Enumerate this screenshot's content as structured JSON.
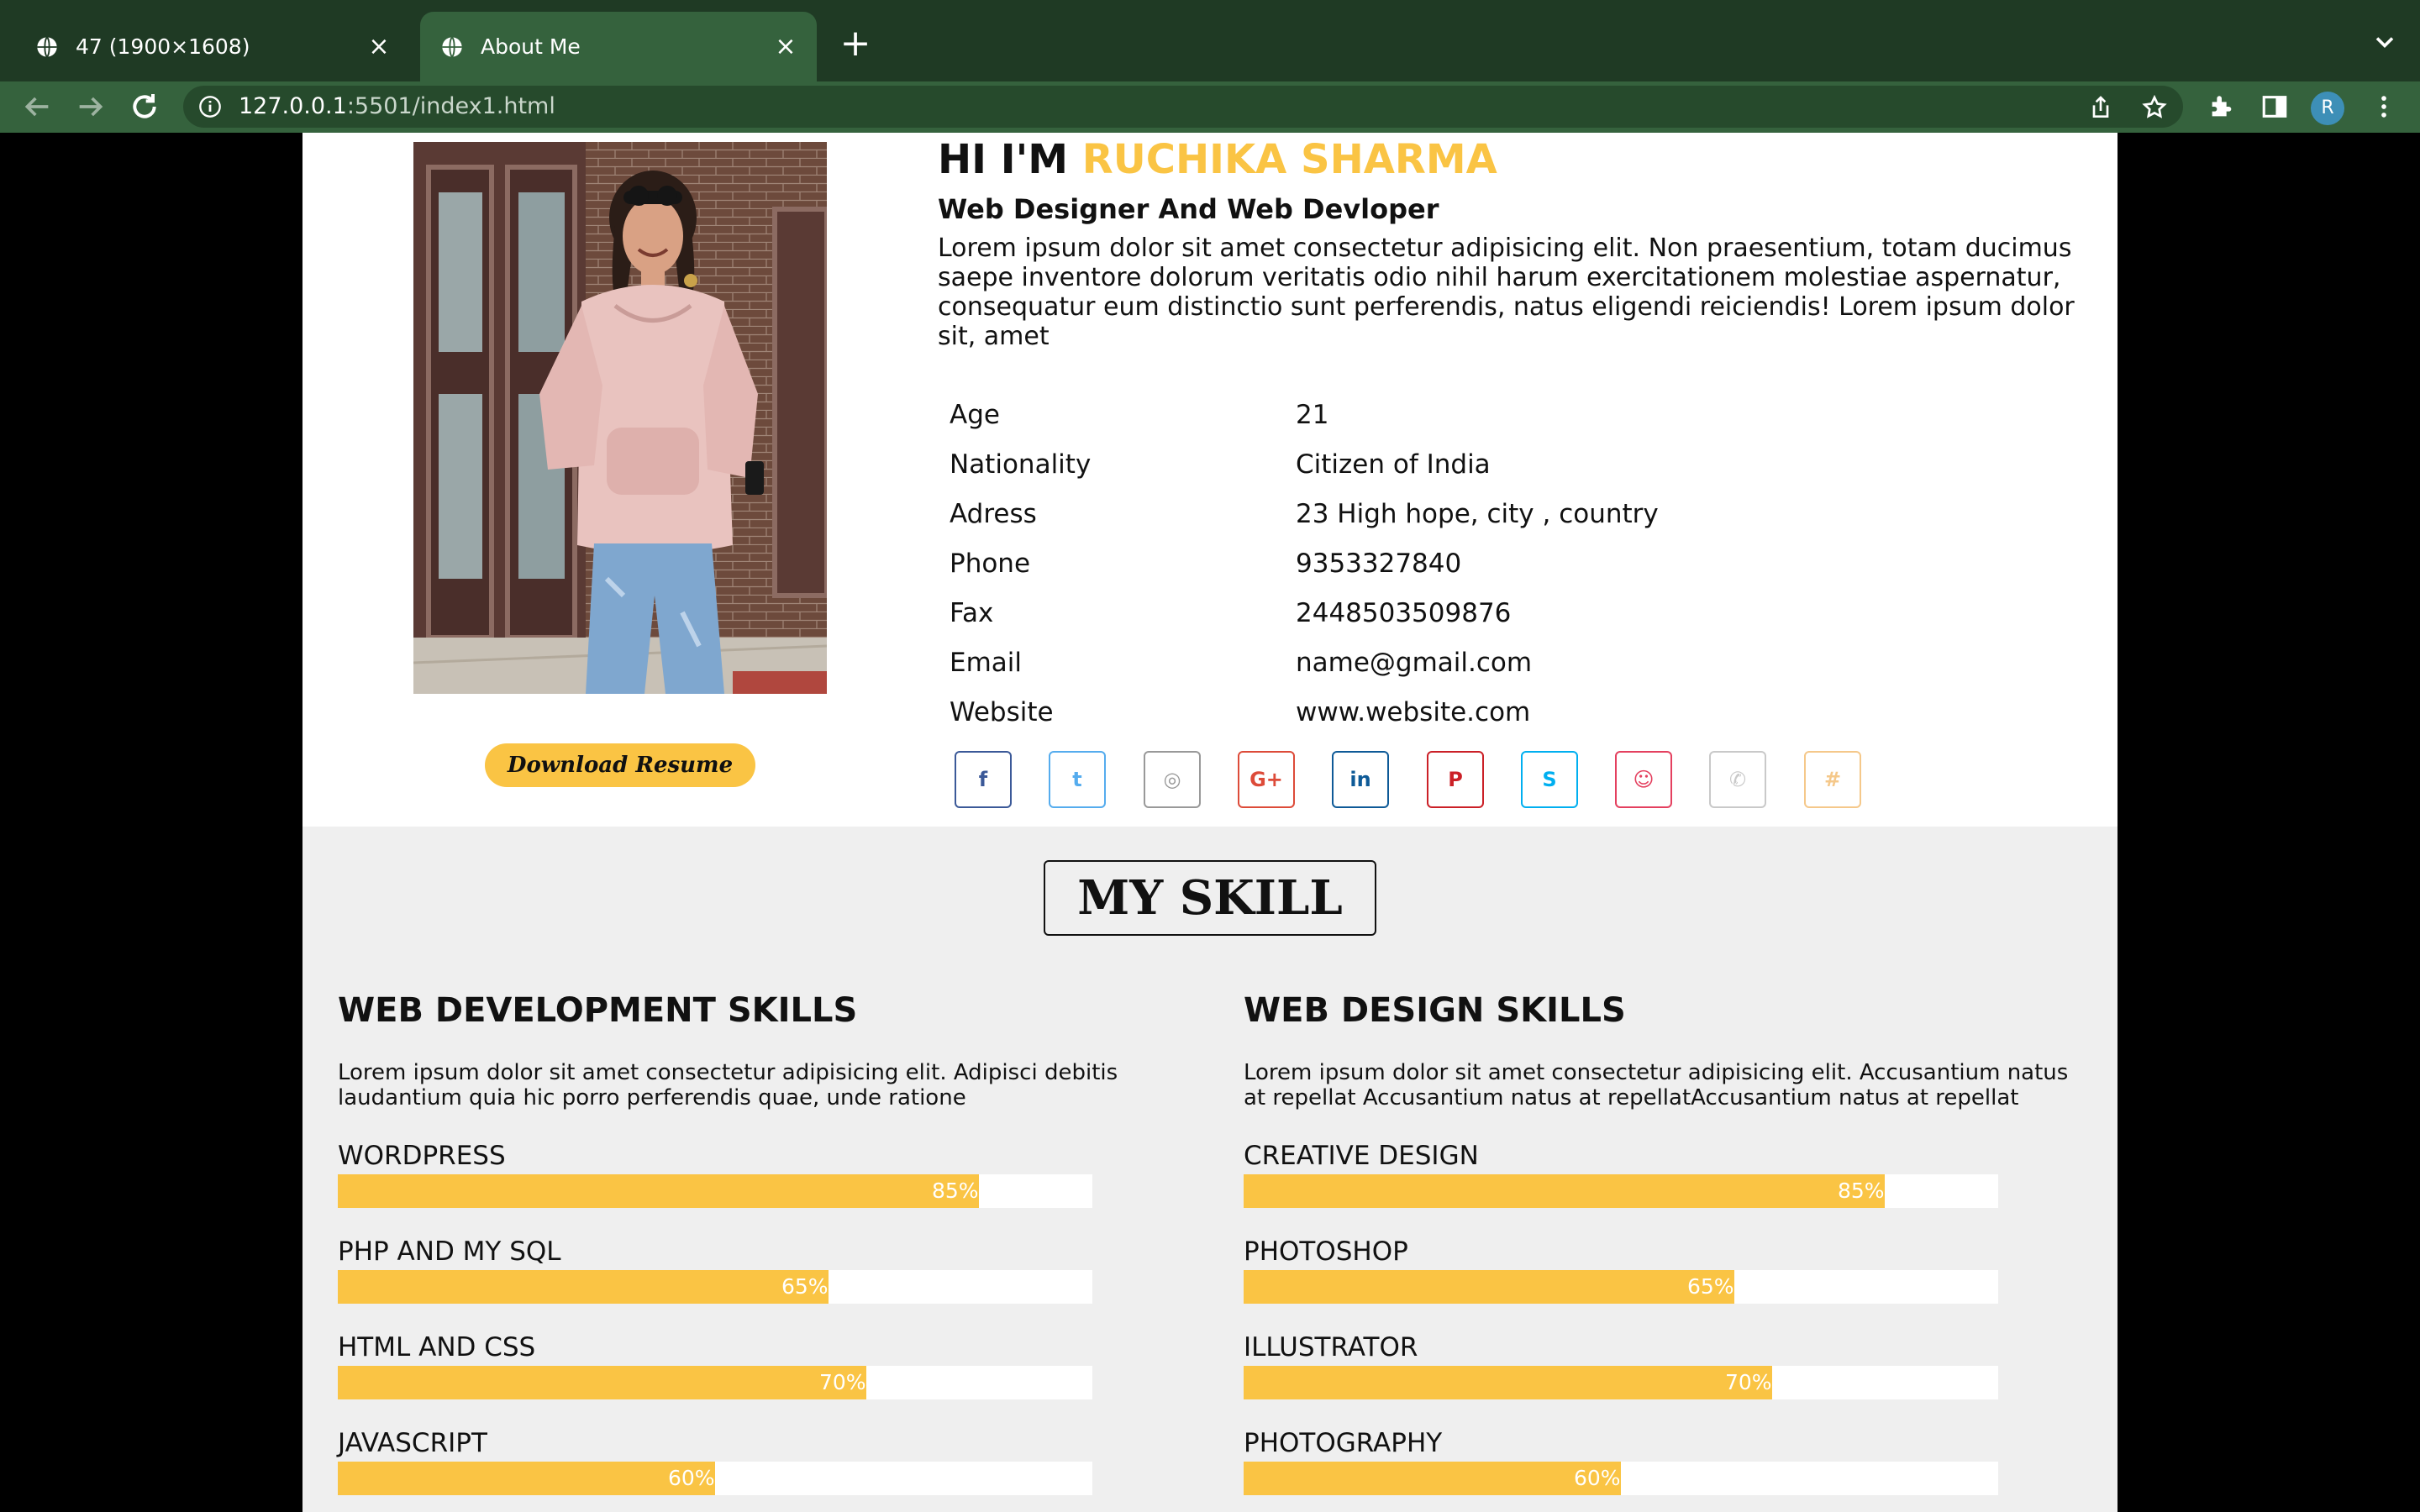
{
  "browser": {
    "tabs": [
      {
        "title": "47 (1900×1608)",
        "active": false
      },
      {
        "title": "About Me",
        "active": true
      }
    ],
    "url_host": "127.0.0.1",
    "url_path": ":5501/index1.html",
    "profile_initial": "R"
  },
  "hero": {
    "greeting": "HI I'M",
    "name": "RUCHIKA SHARMA",
    "role": "Web Designer And Web Devloper",
    "intro": "Lorem ipsum dolor sit amet consectetur adipisicing elit. Non praesentium, totam ducimus saepe inventore dolorum veritatis odio nihil harum exercitationem molestiae aspernatur, consequatur eum distinctio sunt perferendis, natus eligendi reiciendis! Lorem ipsum dolor sit, amet",
    "download_label": "Download Resume"
  },
  "details": [
    {
      "key": "Age",
      "value": "21"
    },
    {
      "key": "Nationality",
      "value": "Citizen of India"
    },
    {
      "key": "Adress",
      "value": "23 High hope, city , country"
    },
    {
      "key": "Phone",
      "value": "9353327840"
    },
    {
      "key": "Fax",
      "value": "2448503509876"
    },
    {
      "key": "Email",
      "value": "name@gmail.com"
    },
    {
      "key": "Website",
      "value": "www.website.com"
    }
  ],
  "social": [
    {
      "name": "facebook",
      "glyph": "f",
      "color": "#3b5998"
    },
    {
      "name": "twitter",
      "glyph": "t",
      "color": "#55acee"
    },
    {
      "name": "instagram",
      "glyph": "◎",
      "color": "#999999"
    },
    {
      "name": "google-plus",
      "glyph": "G+",
      "color": "#dd4b39"
    },
    {
      "name": "linkedin",
      "glyph": "in",
      "color": "#0e5a97"
    },
    {
      "name": "pinterest",
      "glyph": "P",
      "color": "#cb2027"
    },
    {
      "name": "skype",
      "glyph": "S",
      "color": "#00aff0"
    },
    {
      "name": "snapchat",
      "glyph": "☺",
      "color": "#e4405f"
    },
    {
      "name": "whatsapp",
      "glyph": "✆",
      "color": "#c9c9c9"
    },
    {
      "name": "slack",
      "glyph": "#",
      "color": "#f5c88a"
    }
  ],
  "skills": {
    "title": "MY SKILL",
    "columns": [
      {
        "title": "WEB DEVELOPMENT SKILLS",
        "desc": "Lorem ipsum dolor sit amet consectetur adipisicing elit. Adipisci debitis laudantium quia hic porro perferendis quae, unde ratione",
        "items": [
          {
            "label": "WORDPRESS",
            "percent": 85,
            "text": "85%"
          },
          {
            "label": "PHP AND MY SQL",
            "percent": 65,
            "text": "65%"
          },
          {
            "label": "HTML AND CSS",
            "percent": 70,
            "text": "70%"
          },
          {
            "label": "JAVASCRIPT",
            "percent": 50,
            "text": "60%"
          }
        ]
      },
      {
        "title": "WEB DESIGN SKILLS",
        "desc": "Lorem ipsum dolor sit amet consectetur adipisicing elit. Accusantium natus at repellat Accusantium natus at repellatAccusantium natus at repellat",
        "items": [
          {
            "label": "CREATIVE DESIGN",
            "percent": 85,
            "text": "85%"
          },
          {
            "label": "PHOTOSHOP",
            "percent": 65,
            "text": "65%"
          },
          {
            "label": "ILLUSTRATOR",
            "percent": 70,
            "text": "70%"
          },
          {
            "label": "PHOTOGRAPHY",
            "percent": 50,
            "text": "60%"
          }
        ]
      }
    ]
  }
}
